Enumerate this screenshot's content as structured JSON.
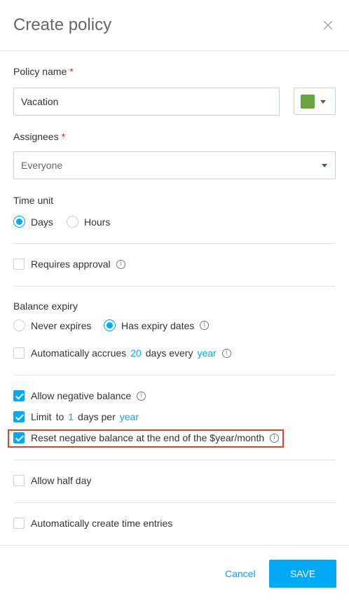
{
  "header": {
    "title": "Create policy"
  },
  "policy_name": {
    "label": "Policy name",
    "required_mark": "*",
    "value": "Vacation",
    "color": "#6aa23d"
  },
  "assignees": {
    "label": "Assignees",
    "required_mark": "*",
    "value": "Everyone"
  },
  "time_unit": {
    "label": "Time unit",
    "options": [
      "Days",
      "Hours"
    ],
    "selected": "Days"
  },
  "requires_approval": {
    "label": "Requires approval",
    "checked": false
  },
  "balance_expiry": {
    "label": "Balance expiry",
    "options": [
      "Never expires",
      "Has expiry dates"
    ],
    "selected": "Has expiry dates"
  },
  "accrual": {
    "prefix": "Automatically accrues",
    "amount": "20",
    "middle": "days every",
    "period": "year",
    "checked": false
  },
  "negative_balance": {
    "label": "Allow negative balance",
    "checked": true
  },
  "limit": {
    "prefix": "Limit",
    "to": "to",
    "amount": "1",
    "middle": "days per",
    "period": "year",
    "checked": true
  },
  "reset_negative": {
    "label": "Reset negative balance at the end of the $year/month",
    "checked": true
  },
  "half_day": {
    "label": "Allow half day",
    "checked": false
  },
  "time_entries": {
    "label": "Automatically create time entries",
    "checked": false
  },
  "footer": {
    "cancel_label": "Cancel",
    "save_label": "SAVE"
  },
  "colors": {
    "accent": "#03a9f4",
    "required": "#e5251d",
    "highlight": "#d9452b"
  }
}
